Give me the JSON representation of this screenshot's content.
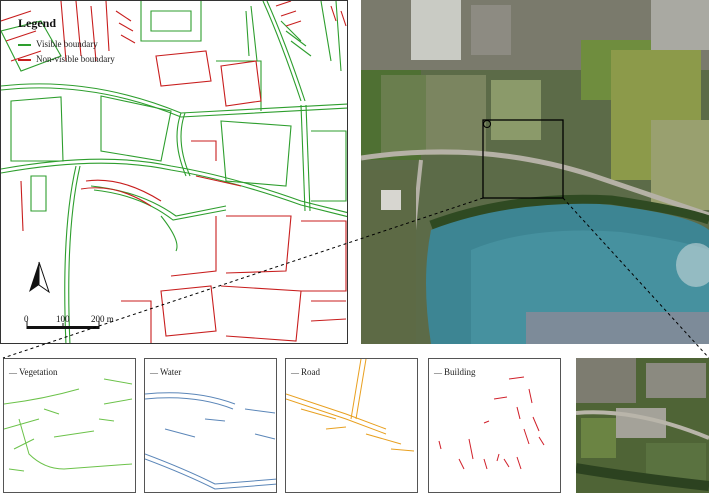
{
  "legend": {
    "title": "Legend",
    "visible_label": "Visible boundary",
    "nonvisible_label": "Non-visible boundary",
    "visible_color": "#2e9e2e",
    "nonvisible_color": "#c81e1e"
  },
  "scale_bar": {
    "label_0": "0",
    "label_100": "100",
    "label_200": "200 m"
  },
  "categories": {
    "vegetation": {
      "label": "Vegetation",
      "color": "#6cc24a"
    },
    "water": {
      "label": "Water",
      "color": "#5b86b8"
    },
    "road": {
      "label": "Road",
      "color": "#e8a020"
    },
    "building": {
      "label": "Building",
      "color": "#d0202a"
    }
  },
  "icons": {
    "north_arrow": "north-arrow-icon"
  }
}
